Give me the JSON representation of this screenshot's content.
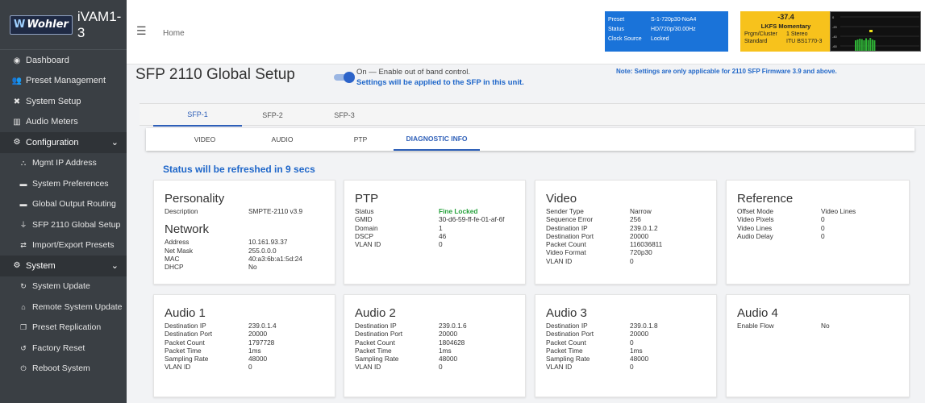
{
  "brand": {
    "logo_text": "Wohler",
    "device": "iVAM1-3"
  },
  "sidebar": {
    "items": [
      {
        "icon": "dashboard-icon",
        "glyph": "◉",
        "label": "Dashboard",
        "type": "item"
      },
      {
        "icon": "preset-management-icon",
        "glyph": "👥",
        "label": "Preset Management",
        "type": "item"
      },
      {
        "icon": "tools-icon",
        "glyph": "✖",
        "label": "System Setup",
        "type": "item"
      },
      {
        "icon": "bar-chart-icon",
        "glyph": "▥",
        "label": "Audio Meters",
        "type": "item"
      },
      {
        "icon": "gear-icon",
        "glyph": "⚙",
        "label": "Configuration",
        "type": "group"
      },
      {
        "icon": "network-icon",
        "glyph": "⛬",
        "label": "Mgmt IP Address",
        "type": "sub"
      },
      {
        "icon": "keyboard-icon",
        "glyph": "▬",
        "label": "System Preferences",
        "type": "sub"
      },
      {
        "icon": "keyboard-icon",
        "glyph": "▬",
        "label": "Global Output Routing",
        "type": "sub"
      },
      {
        "icon": "plug-icon",
        "glyph": "⏚",
        "label": "SFP 2110 Global Setup",
        "type": "sub"
      },
      {
        "icon": "swap-icon",
        "glyph": "⇄",
        "label": "Import/Export Presets",
        "type": "sub"
      },
      {
        "icon": "gears-icon",
        "glyph": "⚙",
        "label": "System",
        "type": "group"
      },
      {
        "icon": "sync-icon",
        "glyph": "↻",
        "label": "System Update",
        "type": "sub"
      },
      {
        "icon": "remote-icon",
        "glyph": "⌂",
        "label": "Remote System Update",
        "type": "sub"
      },
      {
        "icon": "copy-icon",
        "glyph": "❐",
        "label": "Preset Replication",
        "type": "sub"
      },
      {
        "icon": "reset-icon",
        "glyph": "↺",
        "label": "Factory Reset",
        "type": "sub"
      },
      {
        "icon": "power-icon",
        "glyph": "⏻",
        "label": "Reboot System",
        "type": "sub"
      }
    ]
  },
  "header": {
    "breadcrumb": "Home"
  },
  "status_panel": {
    "rows": [
      {
        "key": "Preset",
        "value": "S-1-720p30-NoA4"
      },
      {
        "key": "Status",
        "value": "HD/720p/30.00Hz"
      },
      {
        "key": "Clock Source",
        "value": "Locked"
      }
    ],
    "color": "#1a73d9"
  },
  "loudness_panel": {
    "value": "-37.4",
    "title": "LKFS  Momentary",
    "rows": [
      {
        "key": "Prgm/Cluster",
        "value": "1  Stereo"
      },
      {
        "key": "Standard",
        "value": "ITU BS1770-3"
      }
    ],
    "color": "#f7c21c"
  },
  "meter": {
    "scale_labels": [
      "0",
      "-20",
      "-40",
      "-60"
    ],
    "levels": [
      0.3,
      0.32,
      0.34,
      0.33,
      0.3,
      0.35,
      0.31,
      0.36,
      0.32,
      0.3
    ]
  },
  "page": {
    "title": "SFP 2110 Global Setup",
    "toggle_label": "On — Enable out of band control.",
    "toggle_on": true,
    "sfp_note": "Settings will be applied to the SFP in this unit.",
    "firmware_note": "Note: Settings are only applicable for 2110 SFP Firmware 3.9 and above.",
    "refresh_text": "Status will be refreshed in 9 secs"
  },
  "sfp_tabs": [
    "SFP-1",
    "SFP-2",
    "SFP-3"
  ],
  "sfp_active": 0,
  "sub_tabs": [
    "VIDEO",
    "AUDIO",
    "PTP",
    "DIAGNOSTIC INFO"
  ],
  "sub_active": 3,
  "cards": {
    "personality": {
      "title": "Personality",
      "rows": [
        {
          "k": "Description",
          "v": "SMPTE-2110 v3.9"
        }
      ],
      "sub_title": "Network",
      "sub_rows": [
        {
          "k": "Address",
          "v": "10.161.93.37"
        },
        {
          "k": "Net Mask",
          "v": "255.0.0.0"
        },
        {
          "k": "MAC",
          "v": "40:a3:6b:a1:5d:24"
        },
        {
          "k": "DHCP",
          "v": "No"
        }
      ]
    },
    "ptp": {
      "title": "PTP",
      "rows": [
        {
          "k": "Status",
          "v": "Fine Locked"
        },
        {
          "k": "GMID",
          "v": "30-d6-59-ff-fe-01-af-6f"
        },
        {
          "k": "Domain",
          "v": "1"
        },
        {
          "k": "DSCP",
          "v": "46"
        },
        {
          "k": "VLAN ID",
          "v": "0"
        }
      ]
    },
    "video": {
      "title": "Video",
      "rows": [
        {
          "k": "Sender Type",
          "v": "Narrow"
        },
        {
          "k": "Sequence Error",
          "v": "256"
        },
        {
          "k": "Destination IP",
          "v": "239.0.1.2"
        },
        {
          "k": "Destination Port",
          "v": "20000"
        },
        {
          "k": "Packet Count",
          "v": "116036811"
        },
        {
          "k": "Video Format",
          "v": "720p30"
        },
        {
          "k": "VLAN ID",
          "v": "0"
        }
      ]
    },
    "reference": {
      "title": "Reference",
      "rows": [
        {
          "k": "Offset Mode",
          "v": "Video Lines"
        },
        {
          "k": "Video Pixels",
          "v": "0"
        },
        {
          "k": "Video Lines",
          "v": "0"
        },
        {
          "k": "Audio Delay",
          "v": "0"
        }
      ]
    },
    "audio1": {
      "title": "Audio 1",
      "rows": [
        {
          "k": "Destination IP",
          "v": "239.0.1.4"
        },
        {
          "k": "Destination Port",
          "v": "20000"
        },
        {
          "k": "Packet Count",
          "v": "1797728"
        },
        {
          "k": "Packet Time",
          "v": "1ms"
        },
        {
          "k": "Sampling Rate",
          "v": "48000"
        },
        {
          "k": "VLAN ID",
          "v": "0"
        }
      ]
    },
    "audio2": {
      "title": "Audio 2",
      "rows": [
        {
          "k": "Destination IP",
          "v": "239.0.1.6"
        },
        {
          "k": "Destination Port",
          "v": "20000"
        },
        {
          "k": "Packet Count",
          "v": "1804628"
        },
        {
          "k": "Packet Time",
          "v": "1ms"
        },
        {
          "k": "Sampling Rate",
          "v": "48000"
        },
        {
          "k": "VLAN ID",
          "v": "0"
        }
      ]
    },
    "audio3": {
      "title": "Audio 3",
      "rows": [
        {
          "k": "Destination IP",
          "v": "239.0.1.8"
        },
        {
          "k": "Destination Port",
          "v": "20000"
        },
        {
          "k": "Packet Count",
          "v": "0"
        },
        {
          "k": "Packet Time",
          "v": "1ms"
        },
        {
          "k": "Sampling Rate",
          "v": "48000"
        },
        {
          "k": "VLAN ID",
          "v": "0"
        }
      ]
    },
    "audio4": {
      "title": "Audio 4",
      "rows": [
        {
          "k": "Enable Flow",
          "v": "No"
        }
      ]
    }
  }
}
